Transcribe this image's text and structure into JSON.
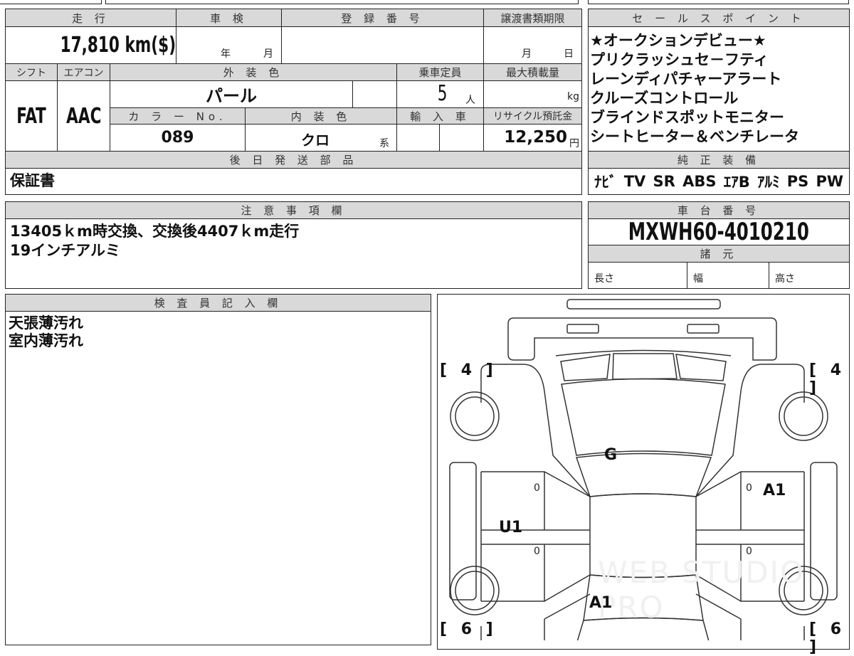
{
  "sheet": {
    "headers": {
      "mileage": "走 行",
      "inspection": "車 検",
      "registration": "登 録 番 号",
      "transfer_deadline": "譲渡書類期限",
      "shift": "シフト",
      "aircon": "エアコン",
      "exterior_color": "外 装 色",
      "capacity": "乗車定員",
      "max_load": "最大積載量",
      "color_no": "カ ラ ー No.",
      "interior_color": "内 装 色",
      "import": "輸 入 車",
      "recycle_fee": "リサイクル預託金",
      "later_parts": "後 日 発 送 部 品",
      "sales_points": "セ ー ル ス ポ イ ン ト",
      "equipment": "純 正 装 備",
      "notes": "注 意 事 項 欄",
      "chassis_no": "車 台 番 号",
      "specs": "諸 元",
      "inspector": "検 査 員 記 入 欄"
    },
    "values": {
      "mileage": "17,810 km($)",
      "inspection_year": "年",
      "inspection_month": "月",
      "deadline_month": "月",
      "deadline_day": "日",
      "shift": "FAT",
      "aircon": "AAC",
      "exterior_color": "パール",
      "capacity": "5",
      "capacity_unit": "人",
      "max_load_unit": "kg",
      "color_no": "089",
      "interior_color": "クロ",
      "interior_suffix": "系",
      "recycle_fee": "12,250",
      "recycle_unit": "円",
      "later_parts": "保証書",
      "chassis_no": "MXWH60-4010210",
      "spec_length": "長さ",
      "spec_width": "幅",
      "spec_height": "高さ"
    },
    "sales_points": [
      "★オークションデビュー★",
      "プリクラッシュセ－フティ",
      "レーンディパチャーアラート",
      "クルーズコントロール",
      "ブラインドスポットモニター",
      "シートヒーター＆ベンチレータ"
    ],
    "equipment": [
      "ﾅﾋﾞ",
      "TV",
      "SR",
      "ABS",
      "ｴｱB",
      "ｱﾙﾐ",
      "PS",
      "PW"
    ],
    "notes": [
      "13405ｋm時交換、交換後4407ｋm走行",
      "19インチアルミ"
    ],
    "inspector_notes": [
      "天張薄汚れ",
      "室内薄汚れ"
    ]
  },
  "diagram": {
    "tire_front_left": "[ 4 ]",
    "tire_front_right": "[ 4 ]",
    "tire_rear_left": "[ 6 ]",
    "tire_rear_right": "[ 6 ]",
    "marks": {
      "windshield": "G",
      "right_front_door": "A1",
      "left_rear_door": "U1",
      "rear": "A1",
      "zero": "0"
    },
    "watermark": "WEB STUDIO PRO"
  }
}
